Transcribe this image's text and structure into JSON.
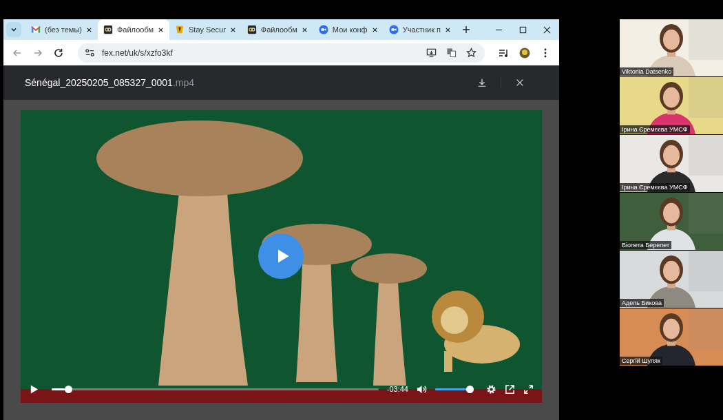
{
  "browser": {
    "tabs": [
      {
        "label": "(без темы)",
        "kind": "mail",
        "selected": false
      },
      {
        "label": "Файлообм",
        "kind": "fex",
        "selected": true
      },
      {
        "label": "Stay Secur",
        "kind": "shield",
        "selected": false
      },
      {
        "label": "Файлообм",
        "kind": "fex",
        "selected": false
      },
      {
        "label": "Мои конф",
        "kind": "zm",
        "selected": false
      },
      {
        "label": "Участник п",
        "kind": "zm",
        "selected": false
      }
    ],
    "address": "fex.net/uk/s/xzfo3kf"
  },
  "viewer": {
    "file_name": "Sénégal_20250205_085327_0001",
    "extension": ".mp4",
    "player": {
      "progress": {
        "level": 0.04
      },
      "time_remaining": "-03:44",
      "volume": {
        "level": 1.0
      }
    }
  },
  "participants": [
    {
      "name": "Viktoriia Datsenko"
    },
    {
      "name": "Ірина Єремєєва УМСФ"
    },
    {
      "name": "Ірина Єремєєва УМСФ"
    },
    {
      "name": "Віолета Берелет"
    },
    {
      "name": "Адель Бикова"
    },
    {
      "name": "Сергій Шуляк"
    }
  ]
}
